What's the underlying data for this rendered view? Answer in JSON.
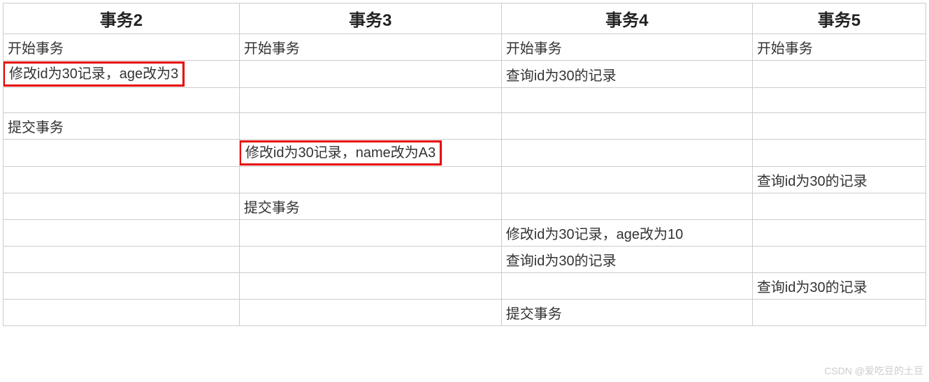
{
  "headers": [
    "事务2",
    "事务3",
    "事务4",
    "事务5"
  ],
  "rows": [
    {
      "c1": "开始事务",
      "c2": "开始事务",
      "c3": "开始事务",
      "c4": "开始事务"
    },
    {
      "c1": "修改id为30记录，age改为3",
      "c1_hl": true,
      "c2": "",
      "c3": "查询id为30的记录",
      "c4": ""
    },
    {
      "c1": "",
      "c2": "",
      "c3": "",
      "c4": ""
    },
    {
      "c1": "提交事务",
      "c2": "",
      "c3": "",
      "c4": ""
    },
    {
      "c1": "",
      "c2": "修改id为30记录，name改为A3",
      "c2_hl": true,
      "c3": "",
      "c4": ""
    },
    {
      "c1": "",
      "c2": "",
      "c3": "",
      "c4": "查询id为30的记录"
    },
    {
      "c1": "",
      "c2": "提交事务",
      "c3": "",
      "c4": ""
    },
    {
      "c1": "",
      "c2": "",
      "c3": "修改id为30记录，age改为10",
      "c4": ""
    },
    {
      "c1": "",
      "c2": "",
      "c3": "查询id为30的记录",
      "c4": ""
    },
    {
      "c1": "",
      "c2": "",
      "c3": "",
      "c4": "查询id为30的记录"
    },
    {
      "c1": "",
      "c2": "",
      "c3": "提交事务",
      "c4": ""
    }
  ],
  "watermark": "CSDN @爱吃豆的土豆"
}
